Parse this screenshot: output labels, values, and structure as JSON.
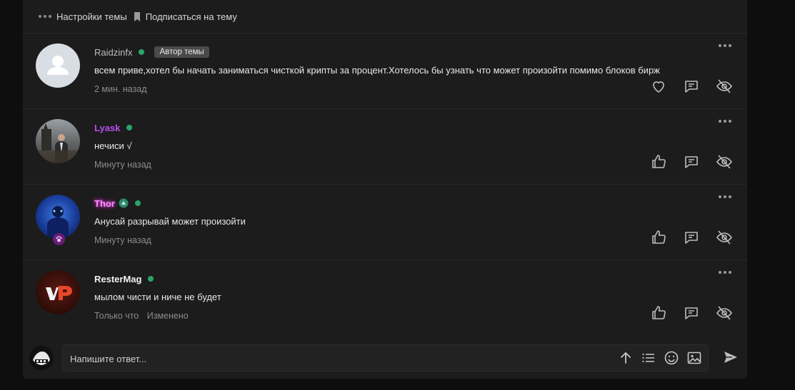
{
  "topbar": {
    "settings_label": "Настройки темы",
    "subscribe_label": "Подписаться на тему"
  },
  "posts": [
    {
      "username": "Raidzinfx",
      "username_color": "#bdbdbd",
      "badge": "Автор темы",
      "text": "всем приве,хотел бы начать заниматься чисткой крипты за процент.Хотелось бы узнать что может произойти помимо блоков бирж",
      "time": "2 мин. назад",
      "edited": "",
      "avatar_icon": "default-user-avatar",
      "like_icon": "heart-icon"
    },
    {
      "username": "Lyask",
      "username_color": "#b44ef0",
      "badge": "",
      "text": "нечиси √",
      "time": "Минуту назад",
      "edited": "",
      "avatar_icon": "photo-avatar",
      "like_icon": "thumbs-up-icon"
    },
    {
      "username": "Thor",
      "username_color": "#ff8cff",
      "badge": "",
      "text": "Анусай разрывай может произойти",
      "time": "Минуту назад",
      "edited": "",
      "avatar_icon": "photo-avatar",
      "like_icon": "thumbs-up-icon"
    },
    {
      "username": "ResterMag",
      "username_color": "#f0f0f0",
      "badge": "",
      "text": "мылом чисти и ниче не будет",
      "time": "Только что",
      "edited": "Изменено",
      "avatar_icon": "logo-avatar",
      "like_icon": "thumbs-up-icon"
    }
  ],
  "composer": {
    "placeholder": "Напишите ответ..."
  },
  "colors": {
    "online": "#2aa56a",
    "background": "#1c1c1c",
    "muted": "#8c8c8c"
  }
}
